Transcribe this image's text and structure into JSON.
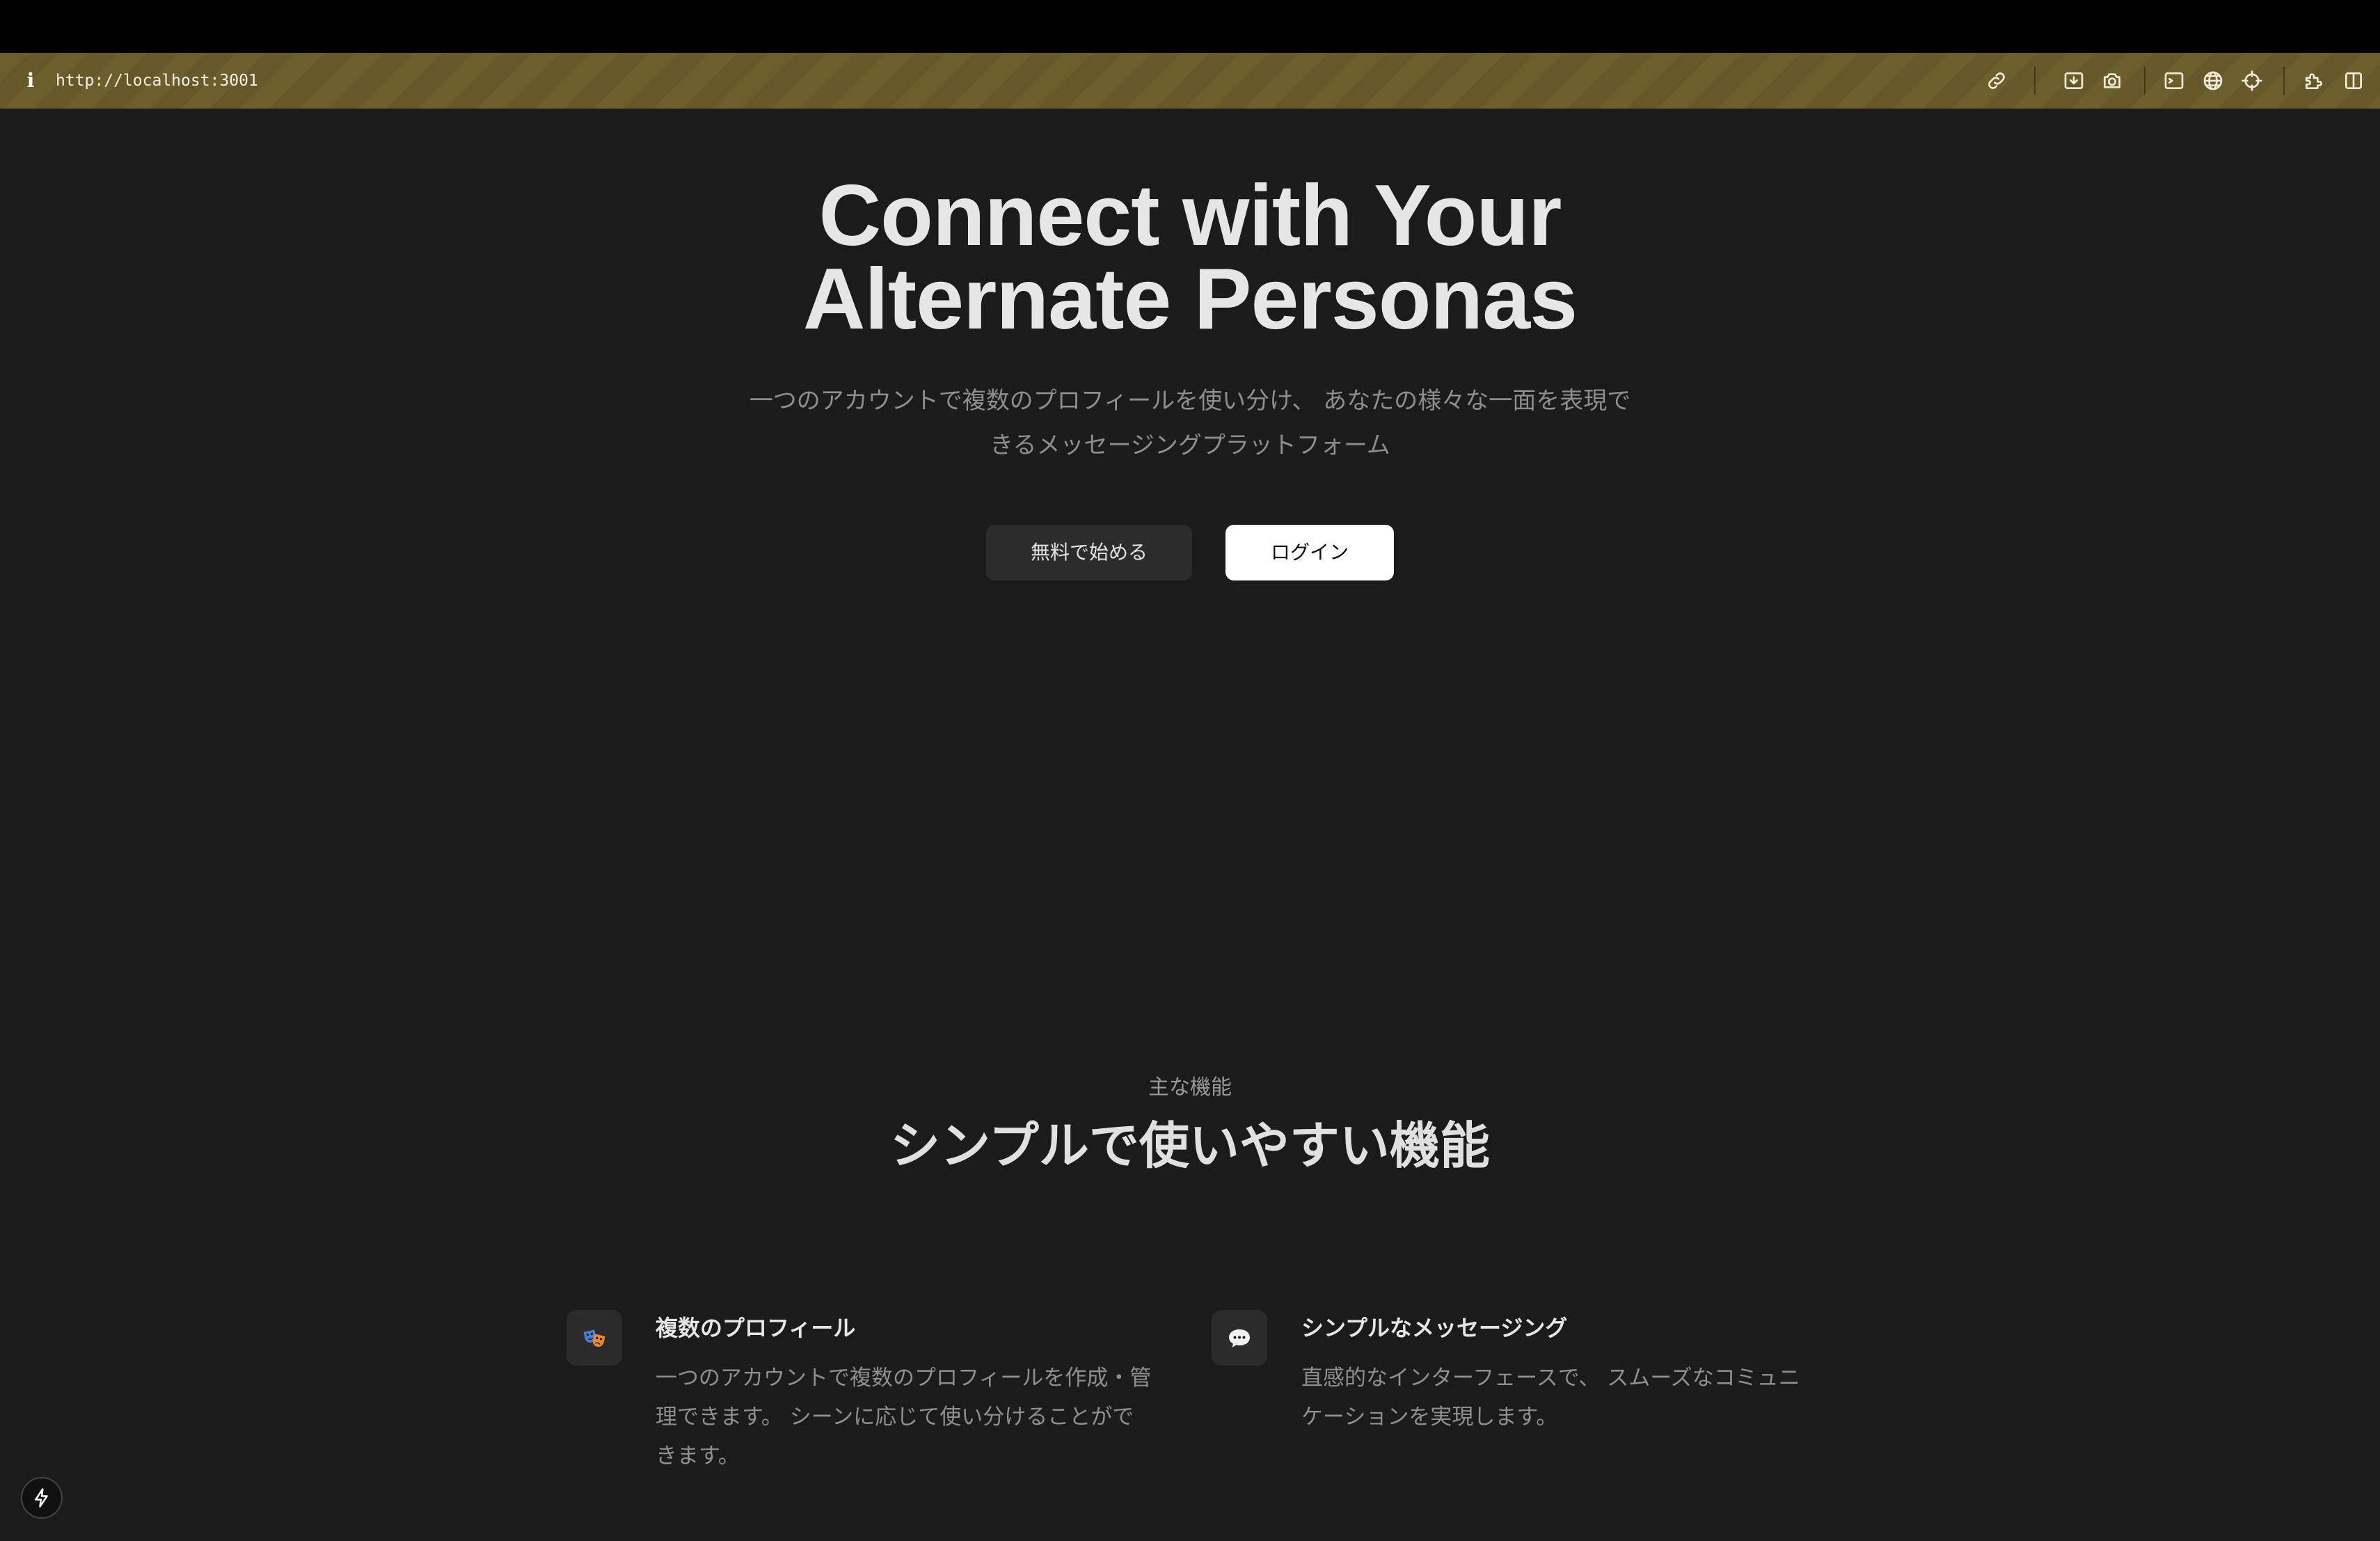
{
  "browser": {
    "url": "http://localhost:3001",
    "toolbar_icons": [
      "link-icon",
      "download-icon",
      "camera-icon",
      "terminal-icon",
      "globe-icon",
      "crosshair-icon",
      "extension-icon",
      "sidebar-toggle-icon"
    ]
  },
  "hero": {
    "title_line1": "Connect with Your",
    "title_line2": "Alternate Personas",
    "subtitle_line1": "一つのアカウントで複数のプロフィールを使い分け、 あなたの様々な一面を表現で",
    "subtitle_line2": "きるメッセージングプラットフォーム",
    "primary_button": "無料で始める",
    "secondary_button": "ログイン"
  },
  "features_section": {
    "eyebrow": "主な機能",
    "title": "シンプルで使いやすい機能",
    "items": [
      {
        "icon": "masks-icon",
        "title": "複数のプロフィール",
        "desc_line1": "一つのアカウントで複数のプロフィールを作成・管",
        "desc_line2": "理できます。 シーンに応じて使い分けることがで",
        "desc_line3": "きます。"
      },
      {
        "icon": "speech-bubble-icon",
        "title": "シンプルなメッセージング",
        "desc_line1": "直感的なインターフェースで、 スムーズなコミュニ",
        "desc_line2": "ケーションを実現します。"
      }
    ]
  },
  "dev_indicator": {
    "icon": "bolt-icon"
  }
}
